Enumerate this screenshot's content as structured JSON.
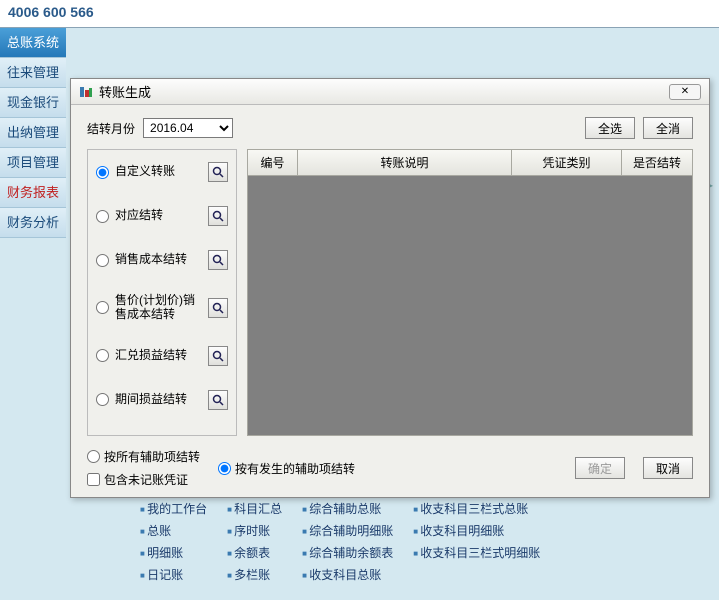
{
  "topbar": {
    "phone": "4006 600 566"
  },
  "sidebar": {
    "items": [
      {
        "label": "总账系统",
        "active": true
      },
      {
        "label": "往来管理"
      },
      {
        "label": "现金银行"
      },
      {
        "label": "出纳管理"
      },
      {
        "label": "项目管理"
      },
      {
        "label": "财务报表",
        "red": true
      },
      {
        "label": "财务分析"
      }
    ]
  },
  "dialog": {
    "title": "转账生成",
    "month_label": "结转月份",
    "month_value": "2016.04",
    "select_all": "全选",
    "select_none": "全消",
    "options": [
      "自定义转账",
      "对应结转",
      "销售成本结转",
      "售价(计划价)销售成本结转",
      "汇兑损益结转",
      "期间损益结转"
    ],
    "selected_option": 0,
    "columns": {
      "c1": "编号",
      "c2": "转账说明",
      "c3": "凭证类别",
      "c4": "是否结转"
    },
    "bottom": {
      "r1": "按所有辅助项结转",
      "r2": "按有发生的辅助项结转",
      "chk": "包含未记账凭证",
      "ok": "确定",
      "cancel": "取消"
    }
  },
  "bg": {
    "col1": [
      "我的工作台",
      "总账",
      "明细账",
      "日记账"
    ],
    "col2": [
      "科目汇总",
      "序时账",
      "余额表",
      "多栏账"
    ],
    "col3": [
      "综合辅助总账",
      "综合辅助明细账",
      "综合辅助余额表",
      "收支科目总账"
    ],
    "col4": [
      "收支科目三栏式总账",
      "收支科目明细账",
      "收支科目三栏式明细账"
    ]
  }
}
